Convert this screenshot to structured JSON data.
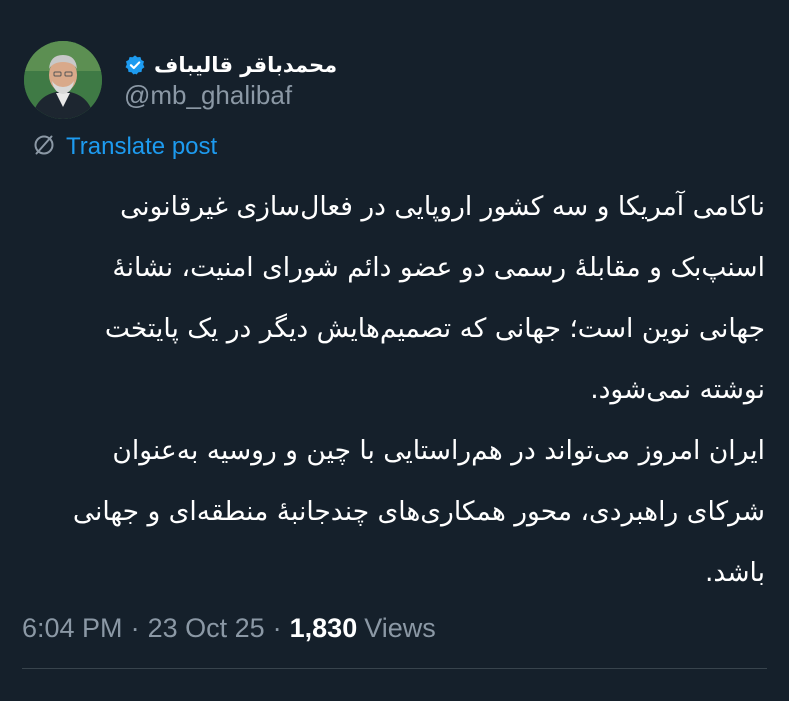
{
  "author": {
    "display_name": "محمدباقر قالیباف",
    "handle": "@mb_ghalibaf",
    "verified": true,
    "avatar_icon": "profile-photo"
  },
  "translate": {
    "label": "Translate post",
    "icon": "translate-globe-icon"
  },
  "post": {
    "lines": [
      "ناکامی آمریکا و سه کشور اروپایی در فعال‌سازی غیرقانونی",
      "اسنپ‌بک و مقابلهٔ رسمی دو عضو دائم شورای امنیت، نشانهٔ",
      "جهانی نوین است؛ جهانی که تصمیم‌هایش دیگر در یک پایتخت",
      "نوشته نمی‌شود.",
      "ایران امروز می‌تواند در هم‌راستایی با چین و روسیه به‌عنوان",
      "شرکای راهبردی، محور همکاری‌های چندجانبهٔ منطقه‌ای و جهانی",
      "باشد."
    ]
  },
  "meta": {
    "time": "6:04 PM",
    "date": "23 Oct 25",
    "separator": "·",
    "views_count": "1,830",
    "views_label": "Views"
  },
  "colors": {
    "background": "#15202b",
    "accent": "#1d9bf0",
    "muted": "#8b98a5",
    "text": "#ffffff"
  }
}
